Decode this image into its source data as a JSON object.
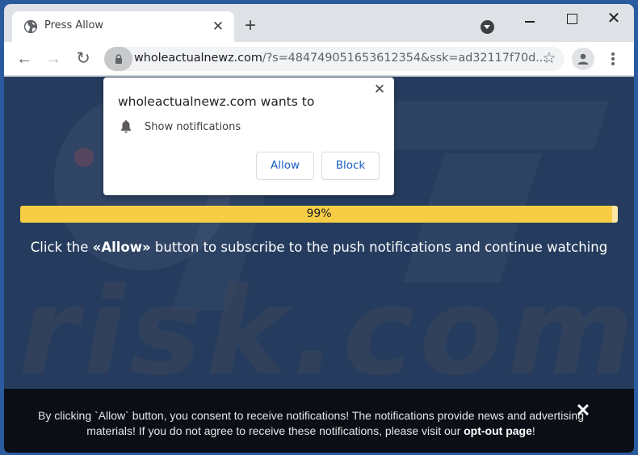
{
  "browser": {
    "tab": {
      "title": "Press Allow",
      "favicon": "globe-icon",
      "close_glyph": "✕"
    },
    "new_tab_glyph": "+",
    "window_controls": {
      "minimize": "minimize-icon",
      "maximize": "maximize-icon",
      "close_glyph": "✕"
    },
    "nav": {
      "back_glyph": "←",
      "forward_glyph": "→",
      "reload_glyph": "↻"
    },
    "address_bar": {
      "domain": "wholeactualnewz.com",
      "path": "/?s=484749051653612354&ssk=ad32117f70d...",
      "secure_icon": "lock-icon"
    },
    "bookmark_glyph": "☆",
    "profile_icon": "person-icon",
    "menu_icon": "kebab-menu-icon"
  },
  "permission_popup": {
    "title": "wholeactualnewz.com wants to",
    "permission": "Show notifications",
    "permission_icon": "bell-icon",
    "allow_label": "Allow",
    "block_label": "Block",
    "close_glyph": "✕"
  },
  "page": {
    "progress": {
      "value_percent": 99,
      "label": "99%",
      "fill_color": "#f7cd46",
      "track_color": "#fbe8a6"
    },
    "headline_prefix": "Click the ",
    "headline_bold": "«Allow»",
    "headline_suffix": " button to subscribe to the push notifications and continue watching",
    "watermark": "risk.com",
    "background_color": "#253c5e"
  },
  "consent_bar": {
    "text": "By clicking `Allow` button, you consent to receive notifications! The notifications provide news and advertising materials! If you do not agree to receive these notifications, please visit our ",
    "link_label": "opt-out page",
    "text_end": "!",
    "close_glyph": "✕"
  }
}
